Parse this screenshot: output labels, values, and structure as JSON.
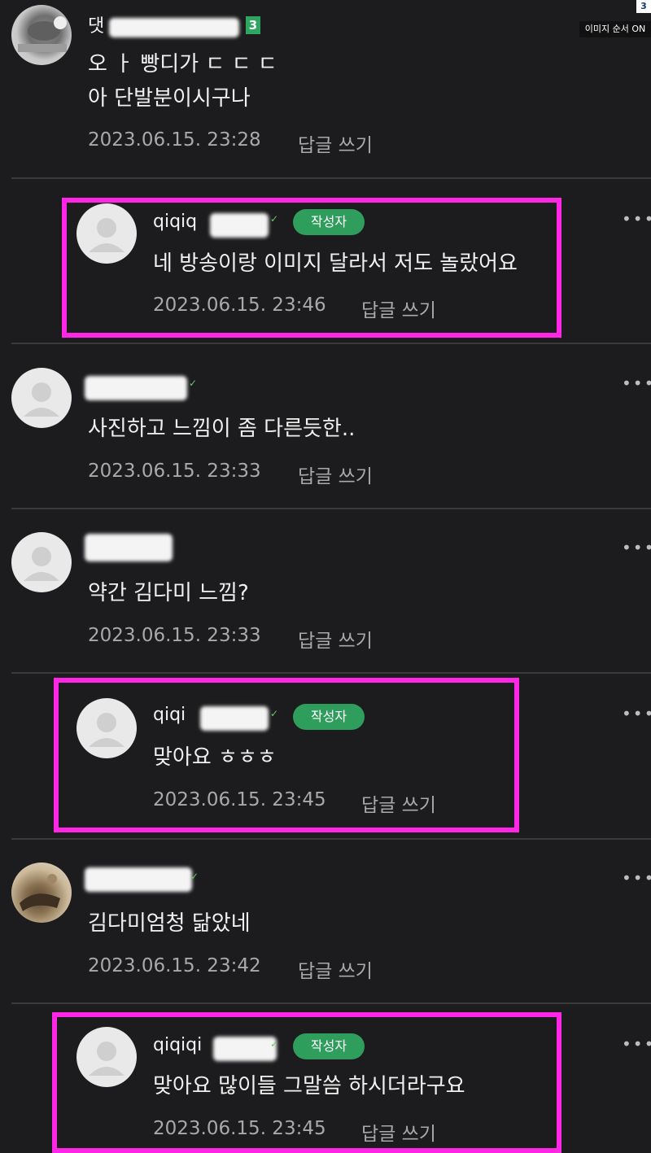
{
  "overlay": {
    "order_toggle": "이미지 순서 ON",
    "corner_number": "3"
  },
  "comments": [
    {
      "nickname_visible": "댓",
      "level_badge": "3",
      "text_lines": [
        "오 ㅏ 빵디가 ㄷ ㄷ ㄷ",
        "아 단발분이시구나"
      ],
      "date": "2023.06.15. 23:28",
      "reply_label": "답글 쓰기",
      "avatar": "photo"
    },
    {
      "nickname_visible": "qiqiq",
      "author_tag": "작성자",
      "text_lines": [
        "네 방송이랑 이미지 달라서 저도 놀랐어요"
      ],
      "date": "2023.06.15. 23:46",
      "reply_label": "답글 쓰기",
      "avatar": "default",
      "is_reply": true,
      "highlighted": true
    },
    {
      "nickname_visible": "",
      "text_lines": [
        "사진하고 느낌이 좀 다른듯한.."
      ],
      "date": "2023.06.15. 23:33",
      "reply_label": "답글 쓰기",
      "avatar": "default"
    },
    {
      "nickname_visible": "",
      "text_lines": [
        "약간 김다미 느낌?"
      ],
      "date": "2023.06.15. 23:33",
      "reply_label": "답글 쓰기",
      "avatar": "default"
    },
    {
      "nickname_visible": "qiqi",
      "author_tag": "작성자",
      "text_lines": [
        "맞아요 ㅎㅎㅎ"
      ],
      "date": "2023.06.15. 23:45",
      "reply_label": "답글 쓰기",
      "avatar": "default",
      "is_reply": true,
      "highlighted": true
    },
    {
      "nickname_visible": "",
      "text_lines": [
        "김다미엄청 닮았네"
      ],
      "date": "2023.06.15. 23:42",
      "reply_label": "답글 쓰기",
      "avatar": "photo"
    },
    {
      "nickname_visible": "qiqiqi",
      "author_tag": "작성자",
      "text_lines": [
        "맞아요 많이들 그말씀 하시더라구요"
      ],
      "date": "2023.06.15. 23:45",
      "reply_label": "답글 쓰기",
      "avatar": "default",
      "is_reply": true,
      "highlighted": true
    }
  ],
  "colors": {
    "background": "#1c1c1e",
    "highlight": "#ff26e5",
    "author_tag": "#2f9e5d",
    "meta_text": "#a9a9a9"
  },
  "icons": {
    "more": "more-dots-icon",
    "verified": "check-icon",
    "default_avatar": "user-silhouette-icon"
  }
}
